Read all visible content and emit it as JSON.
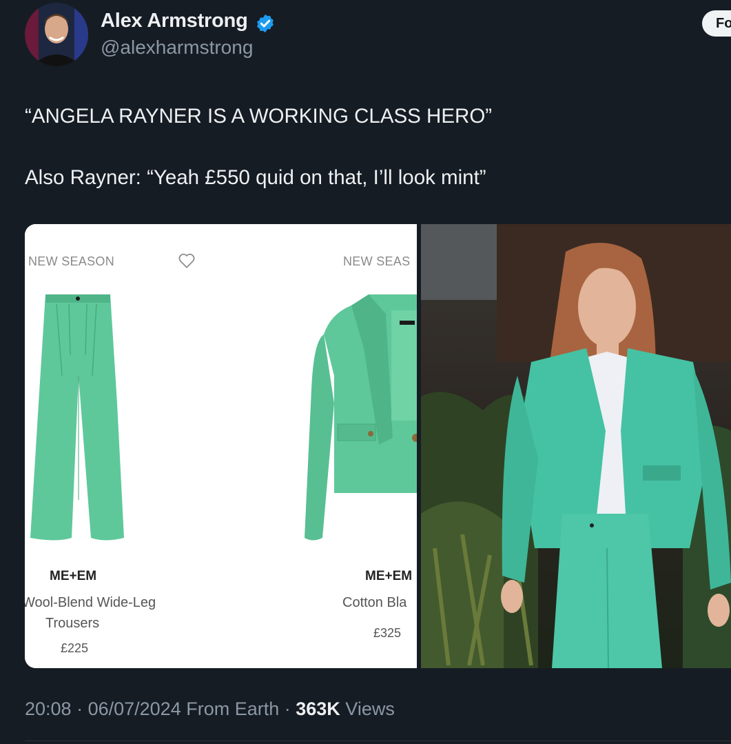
{
  "author": {
    "name": "Alex Armstrong",
    "handle": "@alexharmstrong"
  },
  "follow_button": {
    "label": "Fo"
  },
  "tweet": {
    "line1": "“ANGELA RAYNER IS A WORKING CLASS HERO”",
    "line2": "Also Rayner: “Yeah £550 quid on that, I’ll look mint”"
  },
  "product1": {
    "tag": "NEW SEASON",
    "brand": "ME+EM",
    "name_line1": "Wool-Blend Wide-Leg",
    "name_line2": "Trousers",
    "price": "£225"
  },
  "product2": {
    "tag": "NEW SEAS",
    "brand": "ME+EM",
    "name": "Cotton Bla",
    "price": "£325"
  },
  "meta": {
    "time": "20:08",
    "sep1": " · ",
    "date": "06/07/2024",
    "source": " From Earth",
    "sep2": " · ",
    "views_count": "363K",
    "views_label": " Views"
  },
  "colors": {
    "background": "#161c24",
    "mint": "#5ec89a",
    "verified": "#1d9bf0"
  }
}
